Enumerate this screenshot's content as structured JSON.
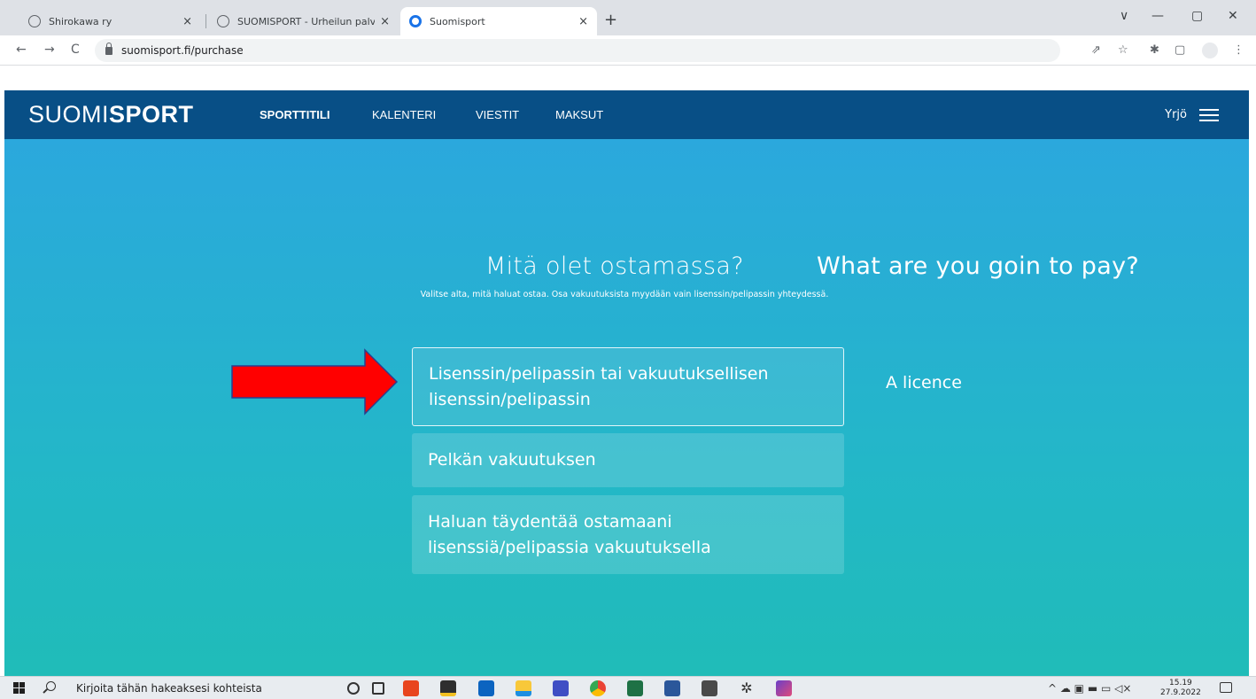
{
  "browser": {
    "tabs": [
      {
        "title": "Shirokawa ry",
        "close": "×"
      },
      {
        "title": "SUOMISPORT - Urheilun palvelut",
        "close": "×"
      },
      {
        "title": "Suomisport",
        "close": "×"
      }
    ],
    "new_tab": "+",
    "window_controls": [
      "∨",
      "—",
      "▢",
      "✕"
    ],
    "address": "suomisport.fi/purchase",
    "nav_glyphs": [
      "←",
      "→",
      "C"
    ],
    "toolbar_glyphs": [
      "⇗",
      "☆",
      "✱",
      "▢",
      "⋮"
    ]
  },
  "site": {
    "logo_light": "SUOMI",
    "logo_bold": "SPORT",
    "nav": [
      {
        "label": "SPORTTITILI"
      },
      {
        "label": "KALENTERI"
      },
      {
        "label": "VIESTIT"
      },
      {
        "label": "MAKSUT"
      }
    ],
    "user_name": "Yrjö"
  },
  "main": {
    "heading": "Mitä olet ostamassa?",
    "heading_en": "What are you goin to pay?",
    "subtitle": "Valitse alta, mitä haluat ostaa. Osa vakuutuksista myydään vain lisenssin/pelipassin yhteydessä.",
    "options": [
      {
        "label": "Lisenssin/pelipassin tai vakuutuksellisen lisenssin/pelipassin"
      },
      {
        "label": "Pelkän vakuutuksen"
      },
      {
        "label": "Haluan täydentää ostamaani lisenssiä/pelipassia vakuutuksella"
      }
    ],
    "annotation_en": "A licence",
    "arrow_color": "#ff0000"
  },
  "taskbar": {
    "search_placeholder": "Kirjoita tähän hakeaksesi kohteista",
    "time": "15.19",
    "date": "27.9.2022",
    "tray_glyphs": "^ ☁ ▣ ▬ ▭ ◁×"
  }
}
